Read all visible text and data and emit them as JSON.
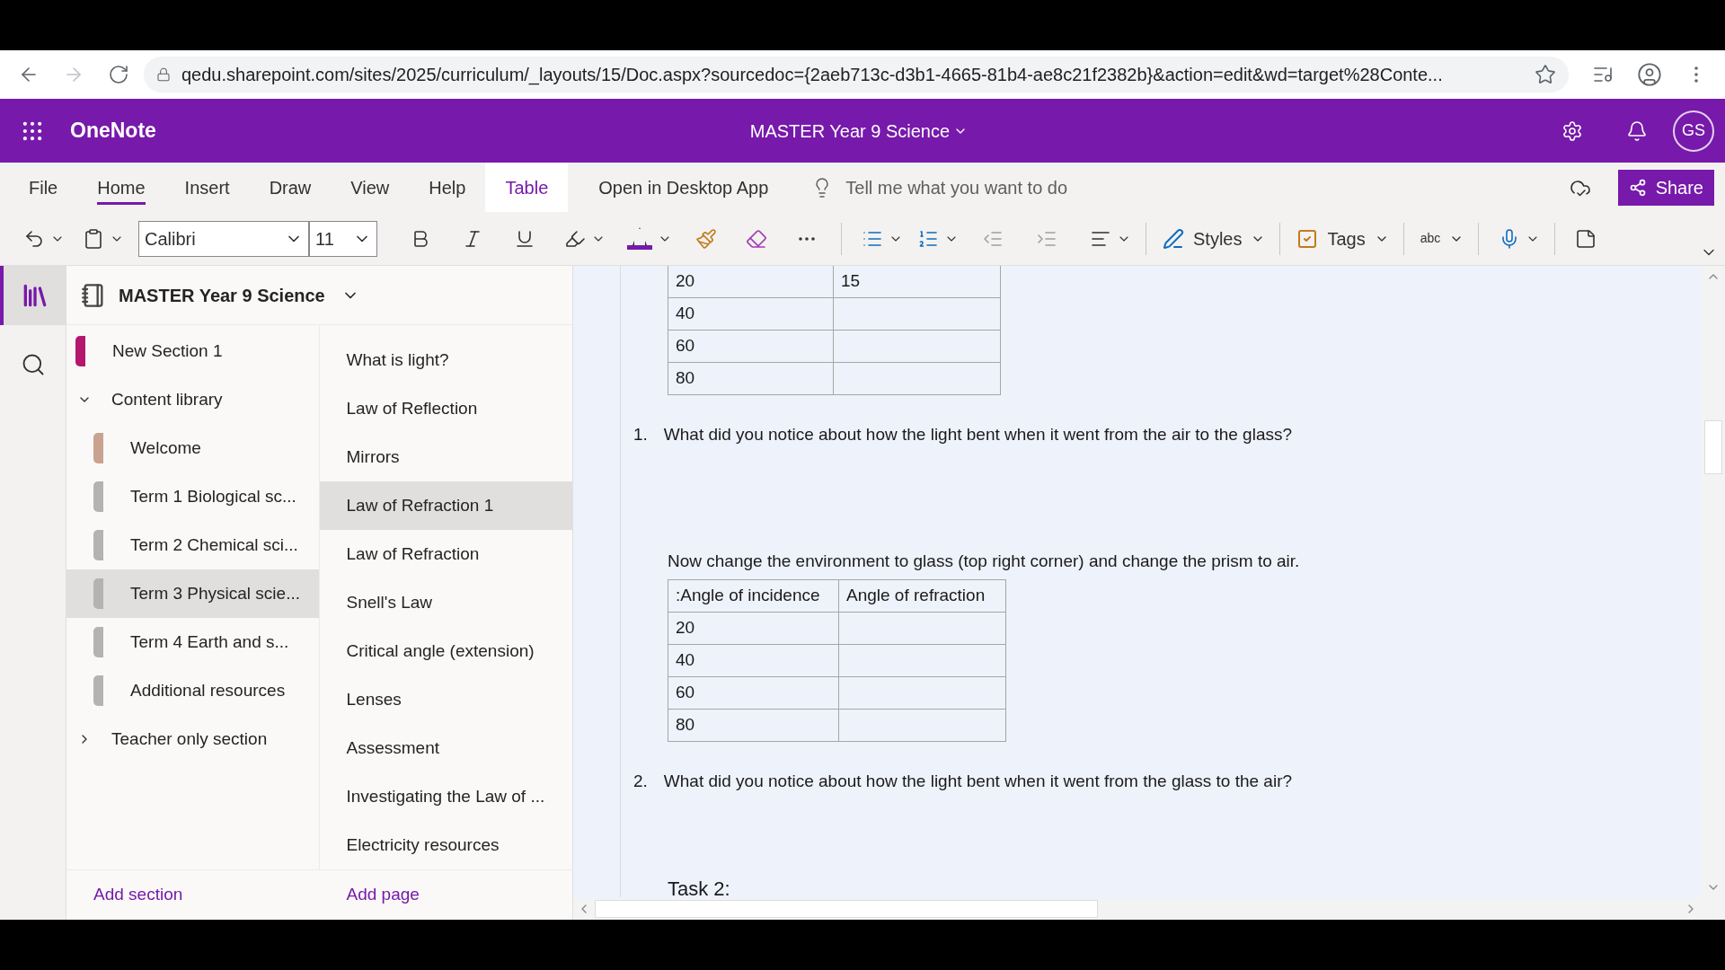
{
  "browser": {
    "url": "qedu.sharepoint.com/sites/2025/curriculum/_layouts/15/Doc.aspx?sourcedoc={2aeb713c-d3b1-4665-81b4-ae8c21f2382b}&action=edit&wd=target%28Conte..."
  },
  "app": {
    "name": "OneNote",
    "notebook": "MASTER Year 9 Science",
    "initials": "GS"
  },
  "ribbon": {
    "tabs": [
      {
        "label": "File",
        "selected": false,
        "kind": "plain"
      },
      {
        "label": "Home",
        "selected": true,
        "kind": "plain"
      },
      {
        "label": "Insert",
        "selected": false,
        "kind": "plain"
      },
      {
        "label": "Draw",
        "selected": false,
        "kind": "plain"
      },
      {
        "label": "View",
        "selected": false,
        "kind": "plain"
      },
      {
        "label": "Help",
        "selected": false,
        "kind": "plain"
      },
      {
        "label": "Table",
        "selected": false,
        "kind": "contextual"
      }
    ],
    "open_desktop": "Open in Desktop App",
    "tell_me": "Tell me what you want to do",
    "share": "Share"
  },
  "toolbar": {
    "font": "Calibri",
    "size": "11",
    "styles": "Styles",
    "tags": "Tags",
    "spelling": "abc"
  },
  "notebook": {
    "title": "MASTER Year 9 Science",
    "add_section": "Add section",
    "sections": [
      {
        "kind": "section",
        "label": "New Section 1",
        "color": "#b4176e",
        "selected": false
      },
      {
        "kind": "group",
        "label": "Content library",
        "expanded": true,
        "children": [
          {
            "kind": "section",
            "label": "Welcome",
            "color": "#c9a390",
            "selected": false
          },
          {
            "kind": "section",
            "label": "Term 1 Biological sc...",
            "color": "#b3b3b3",
            "selected": false
          },
          {
            "kind": "section",
            "label": "Term 2 Chemical sci...",
            "color": "#b3b3b3",
            "selected": false
          },
          {
            "kind": "section",
            "label": "Term 3 Physical scie...",
            "color": "#b3b3b3",
            "selected": true
          },
          {
            "kind": "section",
            "label": "Term 4 Earth and s...",
            "color": "#b3b3b3",
            "selected": false
          },
          {
            "kind": "section",
            "label": "Additional resources",
            "color": "#b3b3b3",
            "selected": false
          }
        ]
      },
      {
        "kind": "group",
        "label": "Teacher only section",
        "expanded": false
      }
    ]
  },
  "pages": {
    "add_page": "Add page",
    "items": [
      {
        "label": "What is light?",
        "selected": false
      },
      {
        "label": "Law of Reflection",
        "selected": false
      },
      {
        "label": "Mirrors",
        "selected": false
      },
      {
        "label": "Law of Refraction 1",
        "selected": true
      },
      {
        "label": "Law of Refraction",
        "selected": false
      },
      {
        "label": "Snell's Law",
        "selected": false
      },
      {
        "label": "Critical angle (extension)",
        "selected": false
      },
      {
        "label": "Lenses",
        "selected": false
      },
      {
        "label": "Assessment",
        "selected": false
      },
      {
        "label": "Investigating the Law of ...",
        "selected": false
      },
      {
        "label": "Electricity resources",
        "selected": false
      }
    ]
  },
  "page": {
    "table_1": {
      "rows": [
        [
          "20",
          "15"
        ],
        [
          "40",
          ""
        ],
        [
          "60",
          ""
        ],
        [
          "80",
          ""
        ]
      ]
    },
    "question_1": {
      "number": "1.",
      "text": "What did you notice about how the light bent when it went from the air to the glass?"
    },
    "instruction": "Now change the environment to glass (top right corner) and change the prism to air.",
    "table_2": {
      "columns": [
        ":Angle of incidence",
        "Angle of refraction"
      ],
      "rows": [
        [
          "20",
          ""
        ],
        [
          "40",
          ""
        ],
        [
          "60",
          ""
        ],
        [
          "80",
          ""
        ]
      ]
    },
    "question_2": {
      "number": "2.",
      "text": "What did you notice about how the light bent when it went from the glass to the air?"
    },
    "task": "Task 2:"
  }
}
